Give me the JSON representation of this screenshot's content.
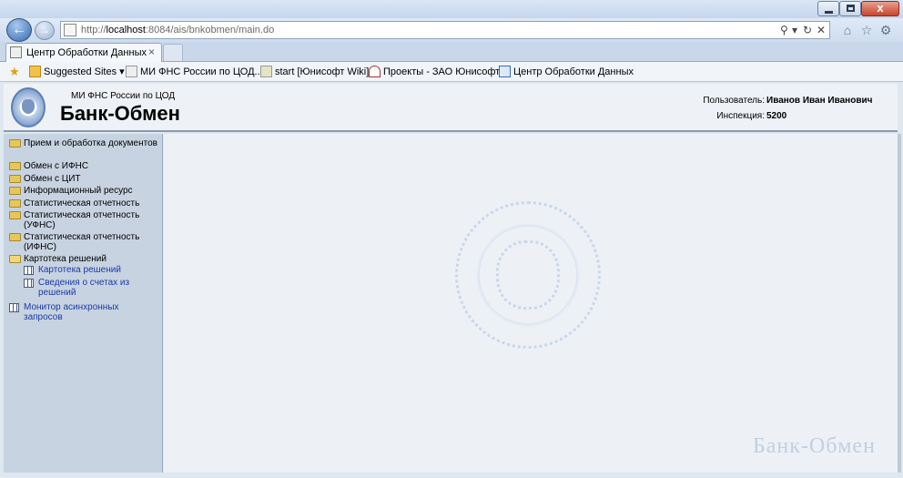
{
  "browser": {
    "address": {
      "prefix": "http://",
      "host": "localhost",
      "rest": ":8084/ais/bnkobmen/main.do"
    },
    "tab_title": "Центр Обработки Данных",
    "tab_close": "×",
    "close_glyph": "x",
    "favorites": [
      {
        "label": "Suggested Sites ▾"
      },
      {
        "label": "МИ ФНС России по ЦОД..."
      },
      {
        "label": "start [Юнисофт Wiki]"
      },
      {
        "label": "Проекты - ЗАО Юнисофт"
      },
      {
        "label": "Центр Обработки Данных"
      }
    ]
  },
  "header": {
    "org_name": "МИ ФНС России по ЦОД",
    "app_title": "Банк-Обмен",
    "user_label": "Пользователь:",
    "user_value": "Иванов Иван Иванович",
    "inspection_label": "Инспекция:",
    "inspection_value": "5200"
  },
  "sidebar": {
    "items": [
      {
        "label": "Прием и обработка документов",
        "icon": "folder-icon"
      },
      {
        "label": "Обмен с ИФНС",
        "icon": "folder-icon"
      },
      {
        "label": "Обмен с ЦИТ",
        "icon": "folder-icon"
      },
      {
        "label": "Информационный ресурс",
        "icon": "folder-icon"
      },
      {
        "label": "Статистическая отчетность",
        "icon": "folder-icon"
      },
      {
        "label": "Статистическая отчетность (УФНС)",
        "icon": "folder-icon"
      },
      {
        "label": "Статистическая отчетность (ИФНС)",
        "icon": "folder-icon"
      },
      {
        "label": "Картотека решений",
        "icon": "folder-open-icon"
      },
      {
        "label": "Картотека решений",
        "icon": "grid-icon"
      },
      {
        "label": "Сведения о счетах из решений",
        "icon": "grid-icon"
      },
      {
        "label": "Монитор асинхронных запросов",
        "icon": "grid-icon"
      }
    ]
  },
  "content": {
    "watermark_text": "Банк-Обмен"
  },
  "colors": {
    "sidebar_bg": "#c7d3e0",
    "link": "#1a3aa8",
    "content_bg": "#edf1f5"
  }
}
